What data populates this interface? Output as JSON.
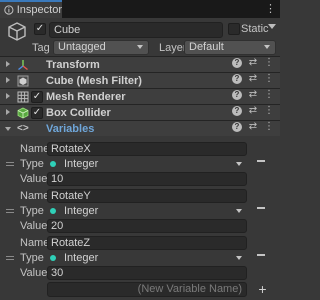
{
  "tab": {
    "label": "Inspector",
    "menu": "⋮"
  },
  "header": {
    "name": "Cube",
    "active_checked": true,
    "static_label": "Static",
    "static_checked": false,
    "tag_label": "Tag",
    "tag_value": "Untagged",
    "layer_label": "Layer",
    "layer_value": "Default"
  },
  "components": [
    {
      "label": "Transform",
      "icon": "transform-icon",
      "has_checkbox": false,
      "expanded": false
    },
    {
      "label": "Cube (Mesh Filter)",
      "icon": "mesh-filter-icon",
      "has_checkbox": false,
      "expanded": false
    },
    {
      "label": "Mesh Renderer",
      "icon": "mesh-renderer-icon",
      "has_checkbox": true,
      "checked": true,
      "expanded": false
    },
    {
      "label": "Box Collider",
      "icon": "box-collider-icon",
      "has_checkbox": true,
      "checked": true,
      "expanded": false
    },
    {
      "label": "Variables",
      "icon": "variables-icon",
      "has_checkbox": false,
      "expanded": true
    }
  ],
  "variables": {
    "name_label": "Name",
    "type_label": "Type",
    "value_label": "Value",
    "items": [
      {
        "name": "RotateX",
        "type": "Integer",
        "value": "10"
      },
      {
        "name": "RotateY",
        "type": "Integer",
        "value": "20"
      },
      {
        "name": "RotateZ",
        "type": "Integer",
        "value": "30"
      }
    ],
    "new_placeholder": "(New Variable Name)",
    "add_label": "+"
  },
  "colors": {
    "accent": "#3a79bb",
    "type_dot": "#2fd0b8",
    "variables_label": "#6fa6d9"
  }
}
